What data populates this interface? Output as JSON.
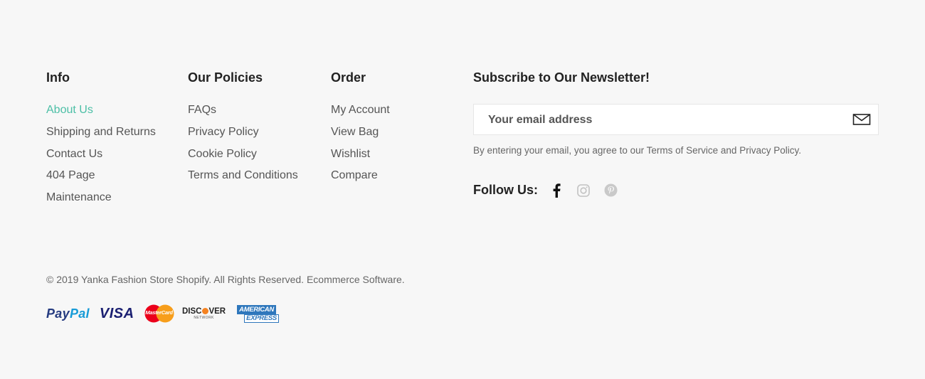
{
  "info": {
    "title": "Info",
    "items": [
      "About Us",
      "Shipping and Returns",
      "Contact Us",
      "404 Page",
      "Maintenance"
    ]
  },
  "policies": {
    "title": "Our Policies",
    "items": [
      "FAQs",
      "Privacy Policy",
      "Cookie Policy",
      "Terms and Conditions"
    ]
  },
  "order": {
    "title": "Order",
    "items": [
      "My Account",
      "View Bag",
      "Wishlist",
      "Compare"
    ]
  },
  "newsletter": {
    "title": "Subscribe to Our Newsletter!",
    "placeholder": "Your email address",
    "agree_text": "By entering your email, you agree to our Terms of Service and Privacy Policy.",
    "send_icon": "mail-icon"
  },
  "follow": {
    "label": "Follow Us:",
    "icons": [
      "facebook-icon",
      "instagram-icon",
      "pinterest-icon"
    ]
  },
  "copyright": "© 2019 Yanka Fashion Store Shopify. All Rights Reserved. Ecommerce Software.",
  "payments": {
    "paypal": {
      "pay": "Pay",
      "pal": "Pal"
    },
    "visa": "VISA",
    "mastercard": "MasterCard",
    "discover": {
      "name": "DISC",
      "name2": "VER",
      "sub": "NETWORK"
    },
    "amex": {
      "line1": "AMERICAN",
      "line2": "EXPRESS"
    }
  },
  "colors": {
    "accent": "#4cbfa6",
    "background": "#f7f7f7",
    "text": "#555555"
  }
}
